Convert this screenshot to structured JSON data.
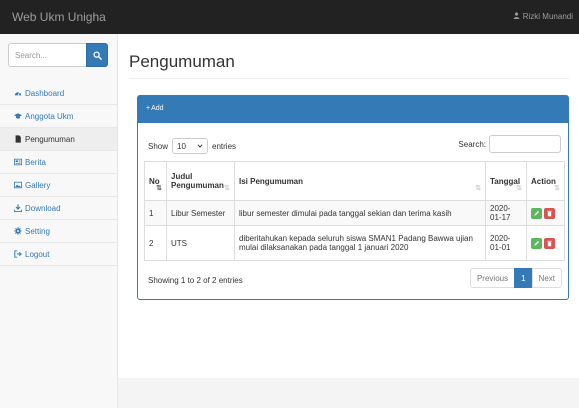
{
  "navbar": {
    "brand": "Web Ukm Unigha",
    "user_name": "Rizki Munandi",
    "user_icon": "user-icon"
  },
  "sidebar": {
    "search_placeholder": "Search...",
    "search_icon": "search-icon",
    "items": [
      {
        "label": "Dashboard",
        "icon": "dashboard-icon",
        "active": false
      },
      {
        "label": "Anggota Ukm",
        "icon": "graduation-cap-icon",
        "active": false
      },
      {
        "label": "Pengumuman",
        "icon": "file-icon",
        "active": true
      },
      {
        "label": "Berita",
        "icon": "newspaper-icon",
        "active": false
      },
      {
        "label": "Gallery",
        "icon": "image-icon",
        "active": false
      },
      {
        "label": "Download",
        "icon": "download-icon",
        "active": false
      },
      {
        "label": "Setting",
        "icon": "gear-icon",
        "active": false
      },
      {
        "label": "Logout",
        "icon": "sign-out-icon",
        "active": false
      }
    ]
  },
  "page": {
    "title": "Pengumuman"
  },
  "panel": {
    "add_label": "Add",
    "length_prefix": "Show",
    "length_value": "10",
    "length_suffix": "entries",
    "search_label": "Search:",
    "info": "Showing 1 to 2 of 2 entries",
    "pagination": {
      "previous": "Previous",
      "current": "1",
      "next": "Next"
    }
  },
  "table": {
    "headers": [
      "No",
      "Judul Pengumuman",
      "Isi Pengumuman",
      "Tanggal",
      "Action"
    ],
    "rows": [
      {
        "no": "1",
        "judul": "Libur Semester",
        "isi": "libur semester dimulai pada tanggal sekian dan terima kasih",
        "tanggal": "2020-01-17"
      },
      {
        "no": "2",
        "judul": "UTS",
        "isi": "diberitahukan kepada seluruh siswa SMAN1 Padang Bawwa ujian mulai dilaksanakan pada tanggal 1 januari 2020",
        "tanggal": "2020-01-01"
      }
    ]
  },
  "colors": {
    "navbar": "#222222",
    "primary": "#337ab7",
    "edit": "#5cb85c",
    "delete": "#d9534f"
  }
}
